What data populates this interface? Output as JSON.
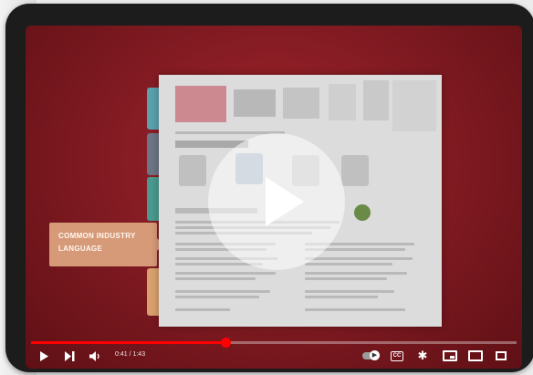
{
  "callout": {
    "line1": "COMMON INDUSTRY",
    "line2": "LANGUAGE"
  },
  "player": {
    "time_label": "0:41 / 1:43",
    "progress": 0.4,
    "cc_label": "CC"
  },
  "icons": {
    "play_big": "play-icon",
    "play": "play-icon",
    "next": "next-icon",
    "volume": "volume-icon",
    "autoplay": "autoplay-toggle-icon",
    "captions": "cc-icon",
    "settings": "gear-icon",
    "miniplayer": "miniplayer-icon",
    "theater": "theater-icon",
    "fullscreen": "fullscreen-icon"
  },
  "colors": {
    "accent": "#ff0000",
    "background": "#8b1d25",
    "callout": "#d69a78"
  }
}
